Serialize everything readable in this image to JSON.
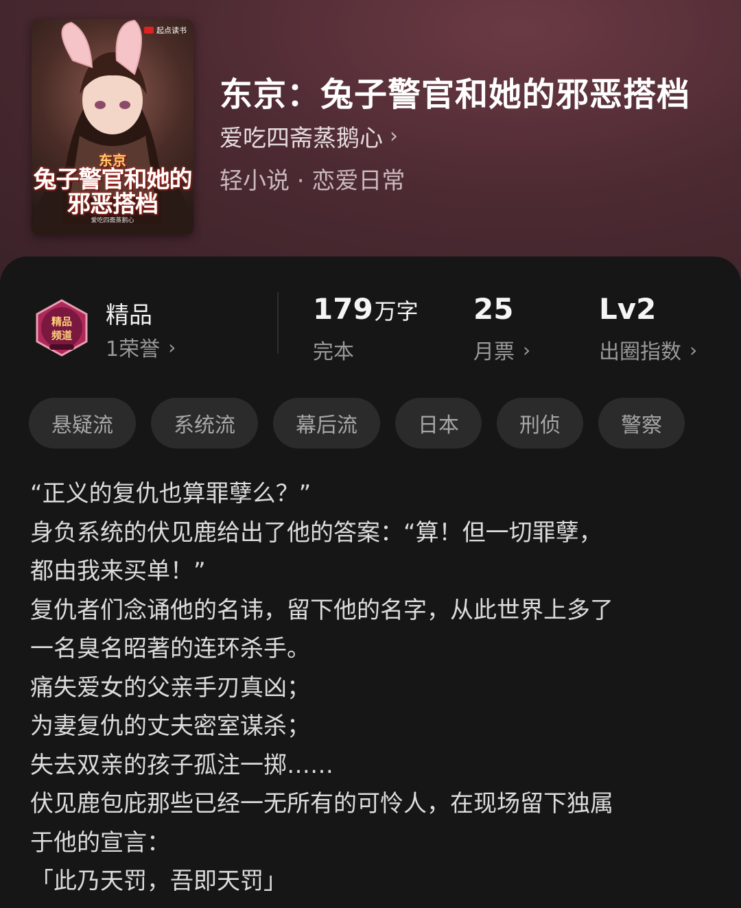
{
  "cover": {
    "publisher": "起点读书",
    "title_small": "东京",
    "title_line1": "兔子警官和她的",
    "title_line2": "邪恶搭档",
    "author_small": "爱吃四斋蒸鹅心"
  },
  "book": {
    "title": "东京：兔子警官和她的邪恶搭档",
    "author": "爱吃四斋蒸鹅心",
    "genre": "轻小说 · 恋爱日常"
  },
  "stats": {
    "badge_label": "精品",
    "honor": "1荣誉",
    "words_num": "179",
    "words_unit": "万字",
    "status": "完本",
    "monthly_votes": "25",
    "monthly_label": "月票",
    "level": "Lv2",
    "level_label": "出圈指数"
  },
  "medal_text": [
    "精品",
    "频道"
  ],
  "tags": [
    "悬疑流",
    "系统流",
    "幕后流",
    "日本",
    "刑侦",
    "警察"
  ],
  "description": [
    "“正义的复仇也算罪孽么？”",
    "身负系统的伏见鹿给出了他的答案：“算！但一切罪孽，",
    "都由我来买单！”",
    "复仇者们念诵他的名讳，留下他的名字，从此世界上多了",
    "一名臭名昭著的连环杀手。",
    "痛失爱女的父亲手刃真凶；",
    "为妻复仇的丈夫密室谋杀；",
    "失去双亲的孩子孤注一掷……",
    "伏见鹿包庇那些已经一无所有的可怜人，在现场留下独属",
    "于他的宣言：",
    "「此乃天罚，吾即天罚」"
  ],
  "colors": {
    "hero_bg": "#4d2a32",
    "panel_bg": "#161616",
    "tag_bg": "#2b2b2b",
    "medal": "#b0285a"
  },
  "icons": {
    "chevron": "chevron-right-icon",
    "medal": "premium-channel-medal-icon"
  }
}
